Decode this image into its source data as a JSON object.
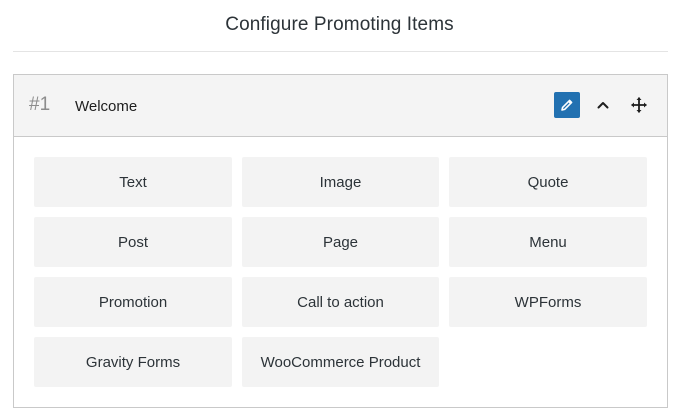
{
  "page": {
    "title": "Configure Promoting Items"
  },
  "item": {
    "number": "#1",
    "title": "Welcome",
    "edit_icon": "pencil-icon",
    "collapse_icon": "chevron-up-icon",
    "move_icon": "move-arrows-icon"
  },
  "types": [
    {
      "label": "Text"
    },
    {
      "label": "Image"
    },
    {
      "label": "Quote"
    },
    {
      "label": "Post"
    },
    {
      "label": "Page"
    },
    {
      "label": "Menu"
    },
    {
      "label": "Promotion"
    },
    {
      "label": "Call to action"
    },
    {
      "label": "WPForms"
    },
    {
      "label": "Gravity Forms"
    },
    {
      "label": "WooCommerce Product"
    }
  ],
  "colors": {
    "accent": "#2271b1",
    "button_bg": "#f3f3f3",
    "header_bg": "#f4f4f4"
  }
}
